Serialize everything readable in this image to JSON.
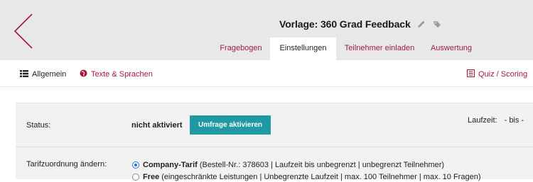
{
  "header": {
    "title": "Vorlage: 360 Grad Feedback",
    "icons": [
      "pencil-icon",
      "tag-icon"
    ]
  },
  "tabs": [
    {
      "label": "Fragebogen",
      "active": false
    },
    {
      "label": "Einstellungen",
      "active": true
    },
    {
      "label": "Teilnehmer einladen",
      "active": false
    },
    {
      "label": "Auswertung",
      "active": false
    }
  ],
  "subnav": {
    "general": "Allgemein",
    "texts": "Texte & Sprachen",
    "quiz": "Quiz / Scoring"
  },
  "status_row": {
    "label": "Status:",
    "value": "nicht aktiviert",
    "button": "Umfrage aktivieren",
    "runtime_label": "Laufzeit:",
    "runtime_value": "- bis -"
  },
  "tariff_row": {
    "label": "Tarifzuordnung ändern:",
    "options": [
      {
        "name": "Company-Tarif",
        "details": "(Bestell-Nr.: 378603 | Laufzeit bis unbegrenzt | unbegrenzt Teilnehmer)",
        "selected": true
      },
      {
        "name": "Free",
        "details": "(eingeschränkte Leistungen | Unbegrenzte Laufzeit | max. 100 Teilnehmer | max. 10 Fragen)",
        "selected": false
      }
    ]
  },
  "colors": {
    "accent": "#a31b3b",
    "button": "#1f9aa4",
    "header_bg": "#e8e8e8",
    "panel_bg": "#f2f2f2"
  }
}
